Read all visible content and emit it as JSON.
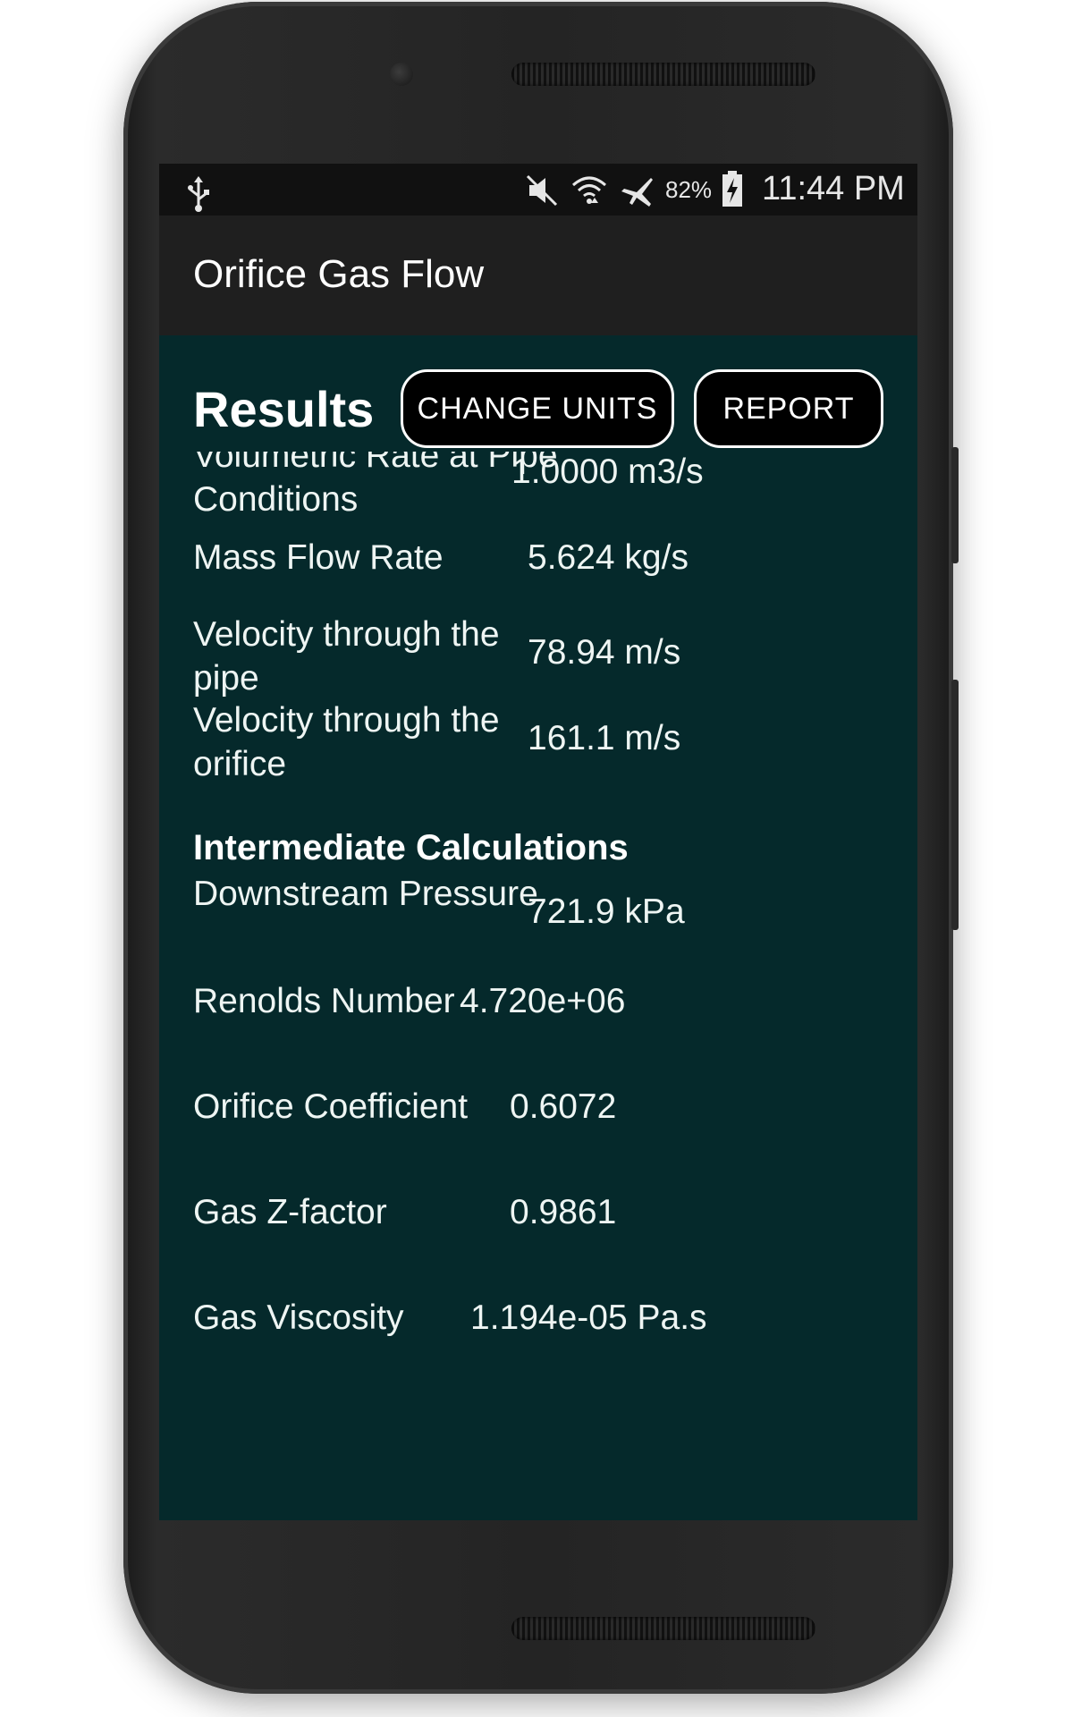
{
  "status_bar": {
    "icons": [
      "usb-icon",
      "mute-icon",
      "wifi-icon",
      "airplane-icon",
      "battery-charging-icon"
    ],
    "battery_percent": "82%",
    "time": "11:44 PM"
  },
  "app": {
    "title": "Orifice Gas Flow"
  },
  "results": {
    "heading": "Results",
    "change_units_label": "CHANGE UNITS",
    "report_label": "REPORT",
    "rows": [
      {
        "label": "Volumetric Rate at Pipe Conditions",
        "value": "1.0000 m3/s"
      },
      {
        "label": "Mass Flow Rate",
        "value": "5.624 kg/s"
      },
      {
        "label": "Velocity through the pipe",
        "value": "78.94 m/s"
      },
      {
        "label": "Velocity through the orifice",
        "value": "161.1 m/s"
      }
    ]
  },
  "intermediate": {
    "heading": "Intermediate Calculations",
    "rows": [
      {
        "label": "Downstream Pressure",
        "value": "721.9 kPa"
      },
      {
        "label": "Renolds Number",
        "value": "4.720e+06"
      },
      {
        "label": "Orifice Coefficient",
        "value": "0.6072"
      },
      {
        "label": "Gas Z-factor",
        "value": "0.9861"
      },
      {
        "label": "Gas Viscosity",
        "value": "1.194e-05 Pa.s"
      }
    ]
  },
  "colors": {
    "screen_background": "#05292b",
    "action_bar": "#1f1f1f",
    "status_bar": "#111111",
    "text": "#eef5f3"
  }
}
